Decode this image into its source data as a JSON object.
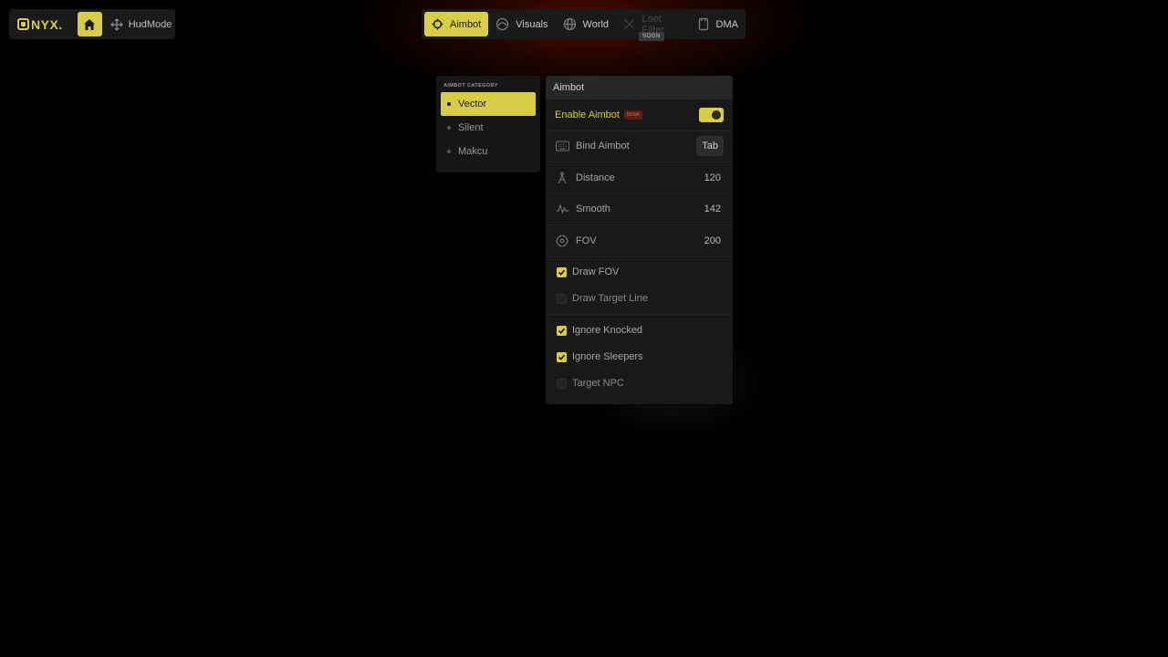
{
  "brand": {
    "name": "NYX.",
    "accent": "#d9cd48"
  },
  "leftbar": {
    "hudmode_label": "HudMode"
  },
  "nav": {
    "tabs": [
      {
        "label": "Aimbot",
        "icon": "crosshair-icon",
        "active": true
      },
      {
        "label": "Visuals",
        "icon": "eye-icon",
        "active": false
      },
      {
        "label": "World",
        "icon": "globe-icon",
        "active": false
      },
      {
        "label": "Loot Filter",
        "icon": "loot-icon",
        "active": false,
        "disabled": true
      },
      {
        "label": "DMA",
        "icon": "chip-icon",
        "active": false
      }
    ],
    "soon_badge": "SOON"
  },
  "category": {
    "title": "AIMBOT CATEGORY",
    "items": [
      {
        "label": "Vector",
        "active": true
      },
      {
        "label": "Silent",
        "active": false
      },
      {
        "label": "Makcu",
        "active": false
      }
    ]
  },
  "settings": {
    "header": "Aimbot",
    "enable": {
      "label": "Enable Aimbot",
      "risk": "RISK",
      "on": true
    },
    "bind": {
      "label": "Bind Aimbot",
      "key": "Tab"
    },
    "distance": {
      "label": "Distance",
      "value": "120"
    },
    "smooth": {
      "label": "Smooth",
      "value": "142"
    },
    "fov": {
      "label": "FOV",
      "value": "200"
    },
    "checks": [
      {
        "label": "Draw FOV",
        "checked": true
      },
      {
        "label": "Draw Target Line",
        "checked": false
      },
      {
        "label": "Ignore Knocked",
        "checked": true
      },
      {
        "label": "Ignore Sleepers",
        "checked": true
      },
      {
        "label": "Target NPC",
        "checked": false
      }
    ]
  }
}
